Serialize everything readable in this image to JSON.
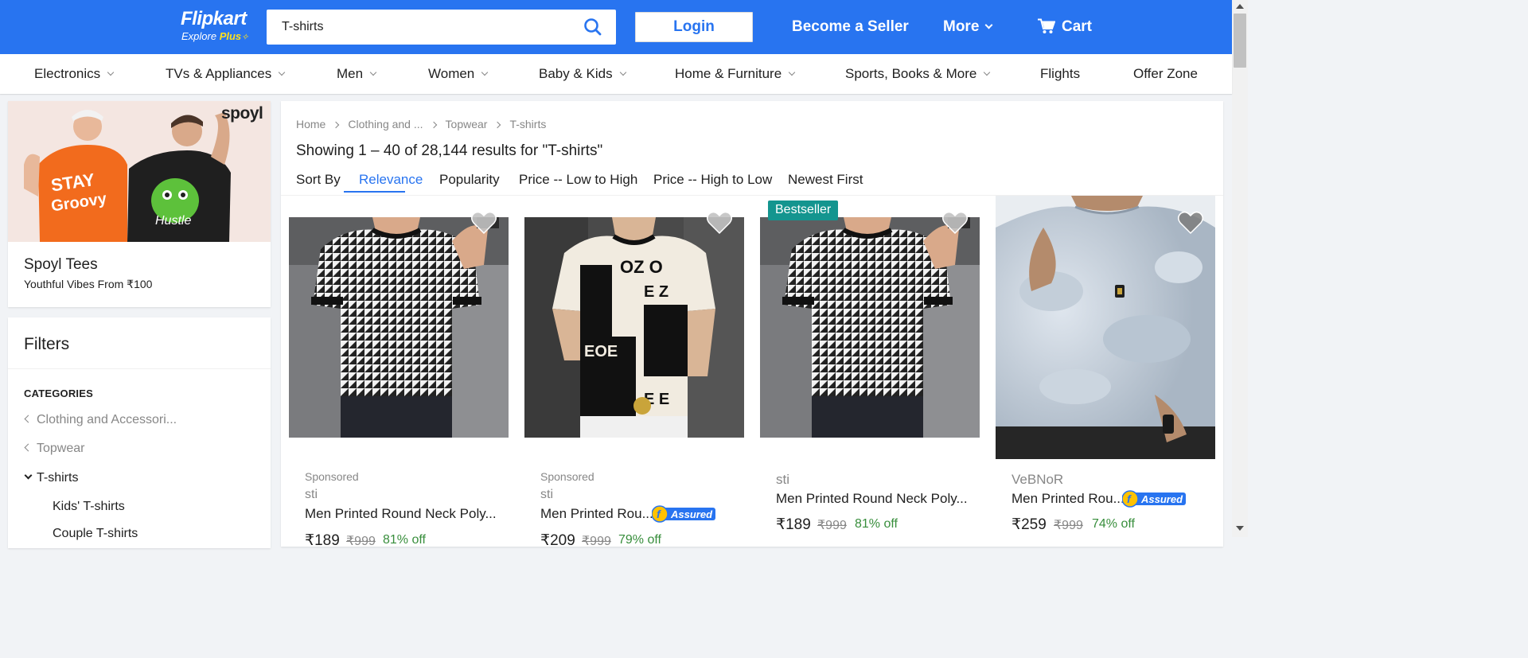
{
  "header": {
    "logo": "Flipkart",
    "logo_sub_explore": "Explore",
    "logo_sub_plus": "Plus",
    "search_value": "T-shirts",
    "login": "Login",
    "become_seller": "Become a Seller",
    "more": "More",
    "cart": "Cart"
  },
  "categories_nav": [
    {
      "label": "Electronics",
      "dropdown": true
    },
    {
      "label": "TVs & Appliances",
      "dropdown": true
    },
    {
      "label": "Men",
      "dropdown": true
    },
    {
      "label": "Women",
      "dropdown": true
    },
    {
      "label": "Baby & Kids",
      "dropdown": true
    },
    {
      "label": "Home & Furniture",
      "dropdown": true
    },
    {
      "label": "Sports, Books & More",
      "dropdown": true
    },
    {
      "label": "Flights",
      "dropdown": false
    },
    {
      "label": "Offer Zone",
      "dropdown": false
    }
  ],
  "banner": {
    "brand_logo": "spoyl",
    "title": "Spoyl Tees",
    "subtitle": "Youthful Vibes From ₹100"
  },
  "filters": {
    "title": "Filters",
    "categories_heading": "CATEGORIES",
    "items": [
      "Clothing and Accessori...",
      "Topwear"
    ],
    "active": "T-shirts",
    "sub_items": [
      "Kids' T-shirts",
      "Couple T-shirts"
    ]
  },
  "breadcrumb": [
    "Home",
    "Clothing and ...",
    "Topwear",
    "T-shirts"
  ],
  "results_text": "Showing 1 – 40 of 28,144 results for \"T-shirts\"",
  "sort": {
    "label": "Sort By",
    "options": [
      "Relevance",
      "Popularity",
      "Price -- Low to High",
      "Price -- High to Low",
      "Newest First"
    ],
    "active": "Relevance"
  },
  "products": [
    {
      "sponsored": "Sponsored",
      "brand": "sti",
      "name": "Men Printed Round Neck Poly...",
      "price": "₹189",
      "mrp": "₹999",
      "off": "81% off",
      "assured": false,
      "badge": ""
    },
    {
      "sponsored": "Sponsored",
      "brand": "sti",
      "name": "Men Printed Rou...",
      "price": "₹209",
      "mrp": "₹999",
      "off": "79% off",
      "assured": true,
      "badge": ""
    },
    {
      "sponsored": "",
      "brand": "sti",
      "name": "Men Printed Round Neck Poly...",
      "price": "₹189",
      "mrp": "₹999",
      "off": "81% off",
      "assured": false,
      "badge": "Bestseller"
    },
    {
      "sponsored": "",
      "brand": "VeBNoR",
      "name": "Men Printed Rou...",
      "price": "₹259",
      "mrp": "₹999",
      "off": "74% off",
      "assured": true,
      "badge": ""
    }
  ],
  "assured_label": "Assured",
  "colors": {
    "brand_blue": "#2874f0",
    "green": "#388e3c",
    "badge_teal": "#14958f",
    "plus_yellow": "#ffe11b"
  },
  "icons": [
    "search-icon",
    "cart-icon",
    "chevron-down-icon",
    "chevron-left-icon",
    "chevron-right-icon",
    "heart-icon",
    "plus-icon",
    "flipkart-f-icon"
  ]
}
